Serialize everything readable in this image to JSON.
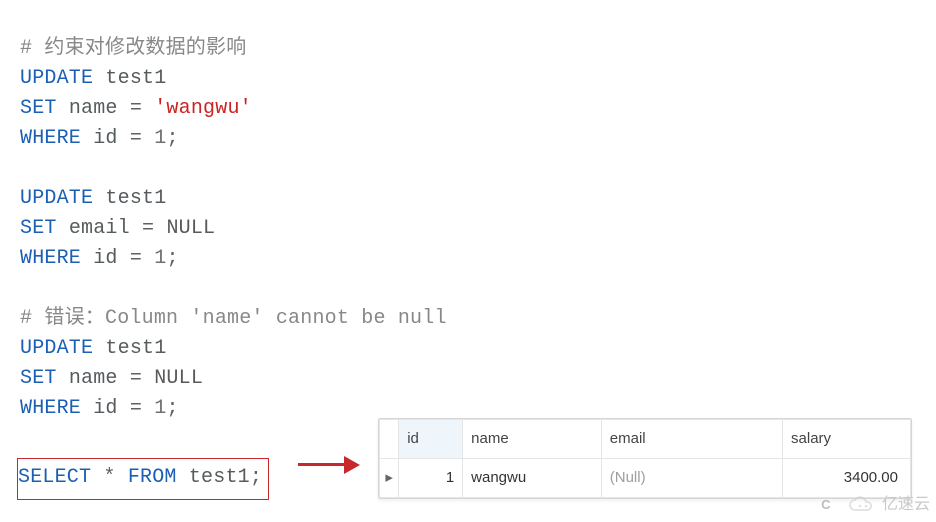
{
  "code": {
    "c1_hash": "# ",
    "c1_text": "约束对修改数据的影响",
    "kw_update": "UPDATE",
    "kw_set": "SET",
    "kw_where": "WHERE",
    "kw_from": "FROM",
    "kw_select": "SELECT",
    "id_test1": "test1",
    "id_name": "name",
    "id_email": "email",
    "id_id": "id",
    "eq": " = ",
    "str_wangwu": "'wangwu'",
    "nul": "NULL",
    "n1": "1",
    "semi": ";",
    "star": "*",
    "c2_hash": "# ",
    "c2_text": "错误：Column 'name' cannot be null"
  },
  "result": {
    "headers": {
      "id": "id",
      "name": "name",
      "email": "email",
      "salary": "salary"
    },
    "row_pointer": "▸",
    "rows": [
      {
        "id": "1",
        "name": "wangwu",
        "email": "(Null)",
        "salary": "3400.00"
      }
    ]
  },
  "marks": {
    "cs": "C",
    "watermark_text": "亿速云"
  }
}
